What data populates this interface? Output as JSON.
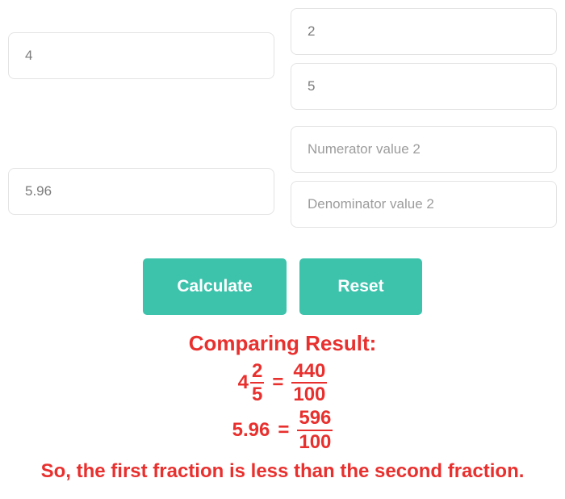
{
  "inputs": {
    "whole1": "4",
    "numerator1": "2",
    "denominator1": "5",
    "whole2": "5.96",
    "numerator2_placeholder": "Numerator value 2",
    "denominator2_placeholder": "Denominator value 2"
  },
  "buttons": {
    "calculate": "Calculate",
    "reset": "Reset"
  },
  "result": {
    "title": "Comparing Result:",
    "line1": {
      "whole": "4",
      "frac_num": "2",
      "frac_den": "5",
      "eq": "=",
      "rhs_num": "440",
      "rhs_den": "100"
    },
    "line2": {
      "lhs": "5.96",
      "eq": "=",
      "rhs_num": "596",
      "rhs_den": "100"
    },
    "conclusion": "So, the first fraction is less than the second fraction."
  }
}
